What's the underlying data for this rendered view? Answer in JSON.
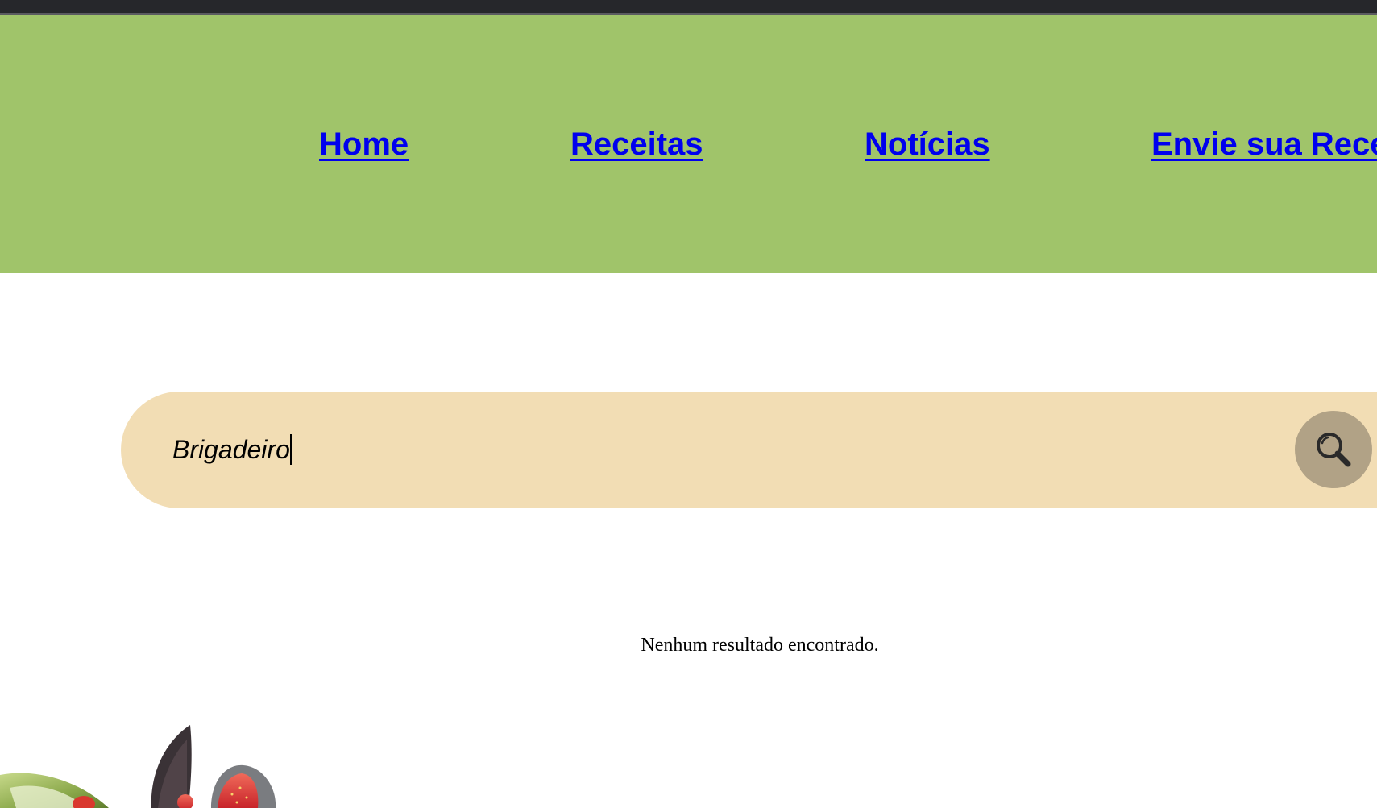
{
  "nav": {
    "items": [
      {
        "label": "Home"
      },
      {
        "label": "Receitas"
      },
      {
        "label": "Notícias"
      },
      {
        "label": "Envie sua Rece"
      }
    ]
  },
  "search": {
    "value": "Brigadeiro",
    "button_icon": "search-icon"
  },
  "results": {
    "empty_message": "Nenhum resultado encontrado."
  },
  "colors": {
    "header_bg": "#a0c46a",
    "link": "#0000ee",
    "search_bg": "#f2ddb4",
    "search_button_bg": "#b1a286"
  }
}
